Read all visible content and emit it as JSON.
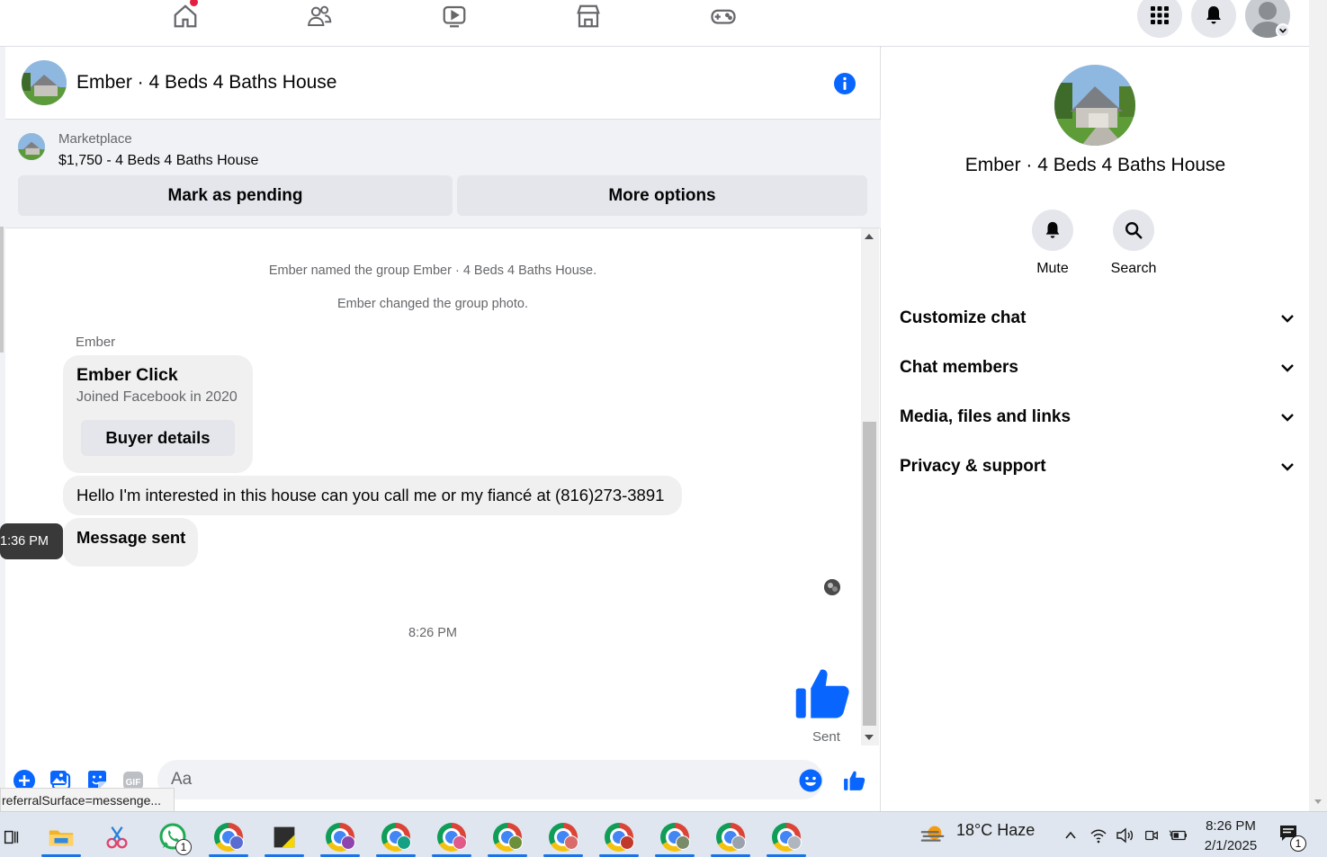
{
  "colors": {
    "accent": "#0866ff",
    "notification": "#e41e3f",
    "bubble": "#f0f0f0",
    "muted_text": "#65676b"
  },
  "topnav": {
    "tabs": [
      "home-icon",
      "friends-icon",
      "watch-icon",
      "marketplace-icon",
      "gaming-icon"
    ],
    "right": [
      "menu-grid-icon",
      "bell-icon",
      "profile-avatar"
    ]
  },
  "chat": {
    "title": "Ember · 4 Beds 4 Baths House",
    "marketplace": {
      "label": "Marketplace",
      "price_title": "$1,750 - 4 Beds 4 Baths House",
      "mark_pending": "Mark as pending",
      "more_options": "More options"
    },
    "system_messages": [
      "Ember named the group Ember · 4 Beds 4 Baths House.",
      "Ember changed the group photo."
    ],
    "sender_name": "Ember",
    "buyer_card": {
      "name": "Ember Click",
      "joined": "Joined Facebook in 2020",
      "button": "Buyer details"
    },
    "message_text": "Hello I'm interested in this house can you call me or my fiancé at (816)273-3891",
    "message_sent": "Message sent",
    "tooltip_time": "1:36 PM",
    "timestamp": "8:26 PM",
    "sent_label": "Sent",
    "composer": {
      "placeholder": "Aa",
      "icons": [
        "add-icon",
        "photo-icon",
        "sticker-icon",
        "gif-icon",
        "emoji-icon",
        "like-icon"
      ]
    },
    "status_url": "referralSurface=messenge..."
  },
  "info_panel": {
    "title": "Ember · 4 Beds 4 Baths House",
    "actions": {
      "mute": "Mute",
      "search": "Search"
    },
    "sections": [
      "Customize chat",
      "Chat members",
      "Media, files and links",
      "Privacy & support"
    ]
  },
  "taskbar": {
    "weather": "18°C  Haze",
    "time": "8:26 PM",
    "date": "2/1/2025",
    "whatsapp_badge": "1",
    "notification_badge": "1"
  }
}
